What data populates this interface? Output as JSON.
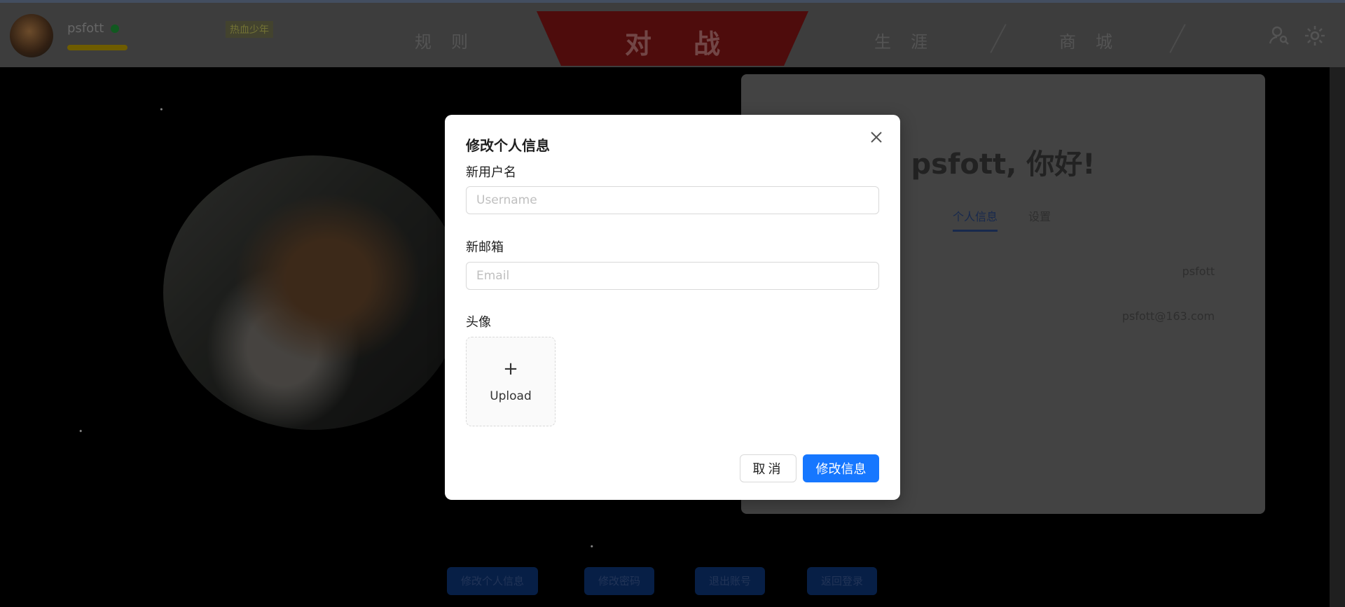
{
  "topbar": {
    "username": "psfott",
    "status_text": "",
    "badge": "热血少年",
    "nav": {
      "left": "规则",
      "battle": "对战",
      "right1": "生涯",
      "right2": "商城"
    }
  },
  "profile": {
    "greeting": "psfott, 你好!",
    "tabs": [
      "个人信息",
      "设置"
    ],
    "username_value": "psfott",
    "email_value": "psfott@163.com"
  },
  "bottom_buttons": [
    "修改个人信息",
    "修改密码",
    "退出账号",
    "返回登录"
  ],
  "modal": {
    "title": "修改个人信息",
    "username_label": "新用户名",
    "username_placeholder": "Username",
    "username_value": "",
    "email_label": "新邮箱",
    "email_placeholder": "Email",
    "email_value": "",
    "avatar_label": "头像",
    "upload_plus": "+",
    "upload_text": "Upload",
    "cancel_label": "取消",
    "ok_label": "修改信息"
  },
  "colors": {
    "primary": "#1677ff",
    "battle_red": "#8e1616",
    "online": "#1fa33b"
  },
  "icons": [
    "close-icon",
    "plus-icon",
    "user-search-icon",
    "gear-icon"
  ]
}
